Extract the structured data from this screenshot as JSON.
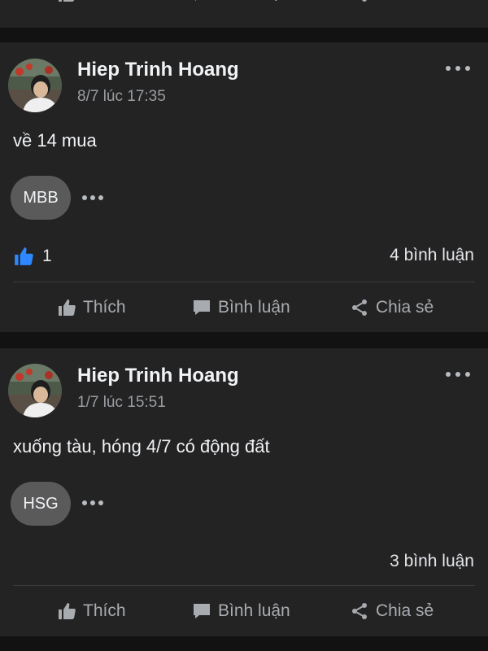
{
  "actions": {
    "like": "Thích",
    "comment": "Bình luận",
    "share": "Chia sẻ"
  },
  "posts": [
    {
      "author": "Hiep Trinh Hoang",
      "time": "8/7 lúc 17:35",
      "text": "về 14 mua",
      "tag": "MBB",
      "likes": "1",
      "comments": "4 bình luận"
    },
    {
      "author": "Hiep Trinh Hoang",
      "time": "1/7 lúc 15:51",
      "text": "xuống tàu, hóng 4/7 có động đất",
      "tag": "HSG",
      "comments": "3 bình luận"
    }
  ],
  "colors": {
    "background": "#121212",
    "card": "#232323",
    "like_blue": "#2d88ff",
    "chip": "#5a5a5a"
  }
}
